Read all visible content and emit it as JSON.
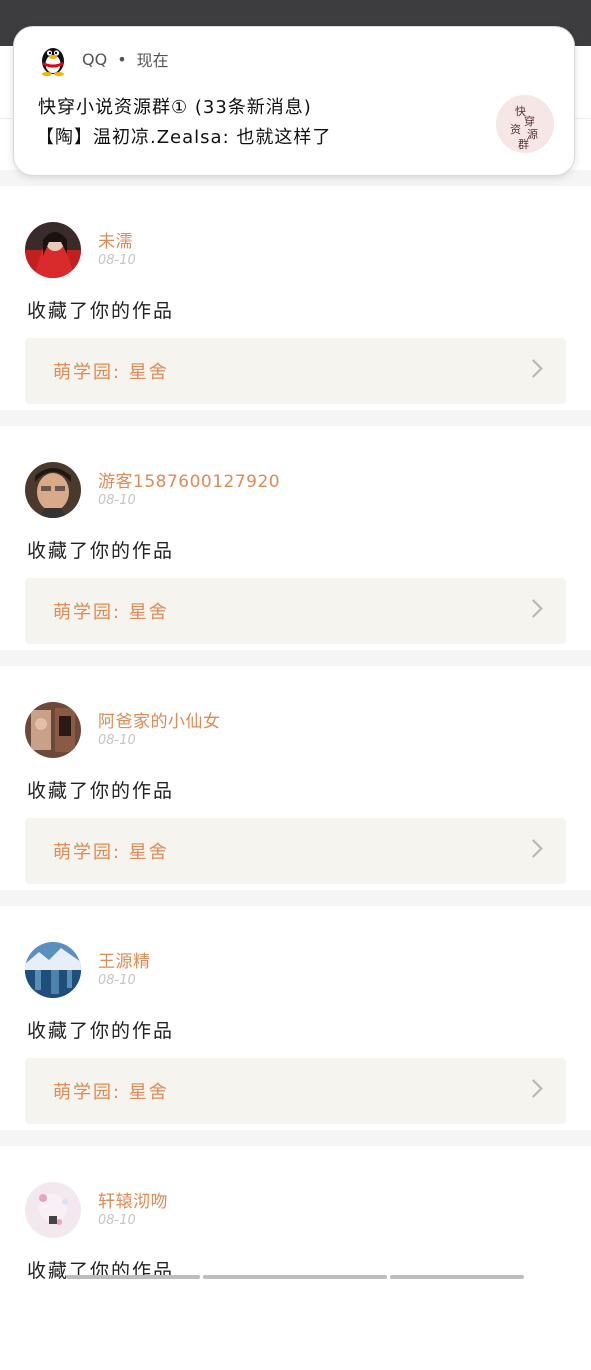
{
  "notification": {
    "app": "QQ",
    "time": "现在",
    "title": "快穿小说资源群① (33条新消息)",
    "body": "【陶】温初凉.Zealsa: 也就这样了",
    "avatar_text": [
      "快",
      "穿",
      "资",
      "源",
      "群"
    ]
  },
  "feed": [
    {
      "username": "未濡",
      "date": "08-10",
      "action": "收藏了你的作品",
      "work": "萌学园: 星舍"
    },
    {
      "username": "游客1587600127920",
      "date": "08-10",
      "action": "收藏了你的作品",
      "work": "萌学园: 星舍"
    },
    {
      "username": "阿爸家的小仙女",
      "date": "08-10",
      "action": "收藏了你的作品",
      "work": "萌学园: 星舍"
    },
    {
      "username": "王源精",
      "date": "08-10",
      "action": "收藏了你的作品",
      "work": "萌学园: 星舍"
    },
    {
      "username": "轩辕沏吻",
      "date": "08-10",
      "action": "收藏了你的作品",
      "work": ""
    }
  ],
  "colors": {
    "accent": "#e08a55",
    "work_bg": "#f5f4ee",
    "status_bar": "#3d3d3f"
  },
  "icons": {
    "notification_app": "qq-penguin-icon",
    "work_arrow": "chevron-right-icon"
  }
}
